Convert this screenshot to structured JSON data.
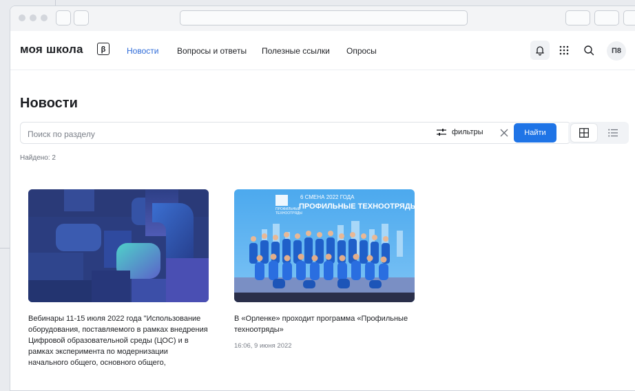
{
  "app": {
    "logo_text": "моя школа",
    "beta_label": "β"
  },
  "nav": {
    "items": [
      {
        "label": "Новости",
        "active": true
      },
      {
        "label": "Вопросы и ответы",
        "active": false
      },
      {
        "label": "Полезные ссылки",
        "active": false
      },
      {
        "label": "Опросы",
        "active": false
      }
    ],
    "icons": [
      "bell-icon",
      "apps-grid-icon",
      "search-icon"
    ],
    "avatar_initials": "П8"
  },
  "page": {
    "title": "Новости",
    "search_placeholder": "Поиск по разделу",
    "filters_label": "фильтры",
    "find_button": "Найти",
    "found_text": "Найдено: 2"
  },
  "cards": [
    {
      "title": "Вебинары 11-15 июля 2022 года \"Использование оборудования, поставляемого в рамках внедрения Цифровой образовательной среды (ЦОС) и в рамках эксперимента по модернизации начального общего, основного общего,",
      "date": ""
    },
    {
      "title": "В «Орленке» проходит программа «Профильные техноотряды»",
      "date": "16:06, 9 июня 2022",
      "banner_line1": "6 СМЕНА 2022 ГОДА",
      "banner_line2": "ПРОФИЛЬНЫЕ ТЕХНООТРЯДЫ",
      "banner_logo": "ПРОФИЛЬНЫЕ ТЕХНООТРЯДЫ"
    }
  ],
  "colors": {
    "accent": "#2e6bd8",
    "button": "#1f74e6",
    "text": "#1c1e22",
    "muted": "#7a7f88"
  }
}
